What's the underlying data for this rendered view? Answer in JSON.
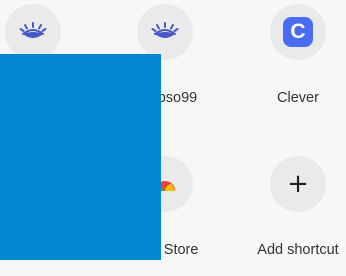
{
  "shortcuts": [
    {
      "label": "",
      "icon": "eye-icon"
    },
    {
      "label": "Thepso99",
      "icon": "eye-icon"
    },
    {
      "label": "Clever",
      "icon": "clever-logo",
      "logo_letter": "C",
      "logo_color": "#4a6cf0"
    },
    {
      "label": "",
      "icon": ""
    },
    {
      "label": "Play Store",
      "icon": "play-store-icon"
    },
    {
      "label": "Add shortcut",
      "icon": "plus-icon",
      "glyph": "+"
    }
  ],
  "overlay": {
    "color": "#0288d1"
  }
}
